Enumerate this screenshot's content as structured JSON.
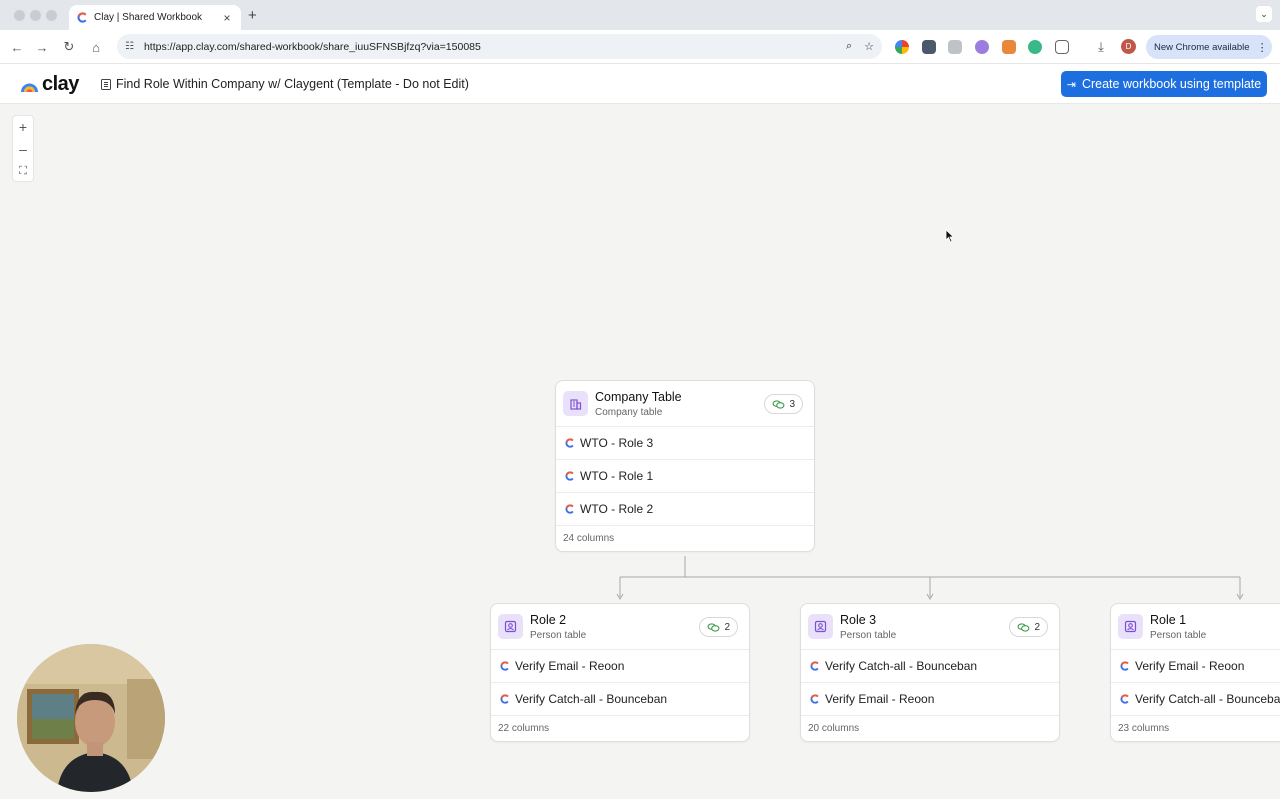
{
  "browser": {
    "tab_title": "Clay | Shared Workbook",
    "tab_close": "×",
    "new_tab": "+",
    "url": "https://app.clay.com/shared-workbook/share_iuuSFNSBjfzq?via=150085",
    "profile_initial": "D",
    "update_label": "New Chrome available"
  },
  "header": {
    "logo_text": "clay",
    "workbook_title": "Find Role Within Company w/ Claygent (Template - Do not Edit)",
    "cta_label": "Create workbook using template"
  },
  "colors": {
    "accent": "#1d6fe0",
    "card_icon_bg": "#e9e1fa",
    "card_icon": "#7c4fd6"
  },
  "canvas": {
    "zoom_in": "+",
    "zoom_out": "–",
    "fit": "⛶"
  },
  "cards": {
    "company": {
      "title": "Company Table",
      "subtitle": "Company table",
      "badge": "3",
      "rows": [
        "WTO - Role 3",
        "WTO - Role 1",
        "WTO - Role 2"
      ],
      "footer": "24 columns"
    },
    "role2": {
      "title": "Role 2",
      "subtitle": "Person table",
      "badge": "2",
      "rows": [
        "Verify Email - Reoon",
        "Verify Catch-all - Bounceban"
      ],
      "footer": "22 columns"
    },
    "role3": {
      "title": "Role 3",
      "subtitle": "Person table",
      "badge": "2",
      "rows": [
        "Verify Catch-all - Bounceban",
        "Verify Email - Reoon"
      ],
      "footer": "20 columns"
    },
    "role1": {
      "title": "Role 1",
      "subtitle": "Person table",
      "rows": [
        "Verify Email - Reoon",
        "Verify Catch-all - Bounceban"
      ],
      "footer": "23 columns"
    }
  }
}
